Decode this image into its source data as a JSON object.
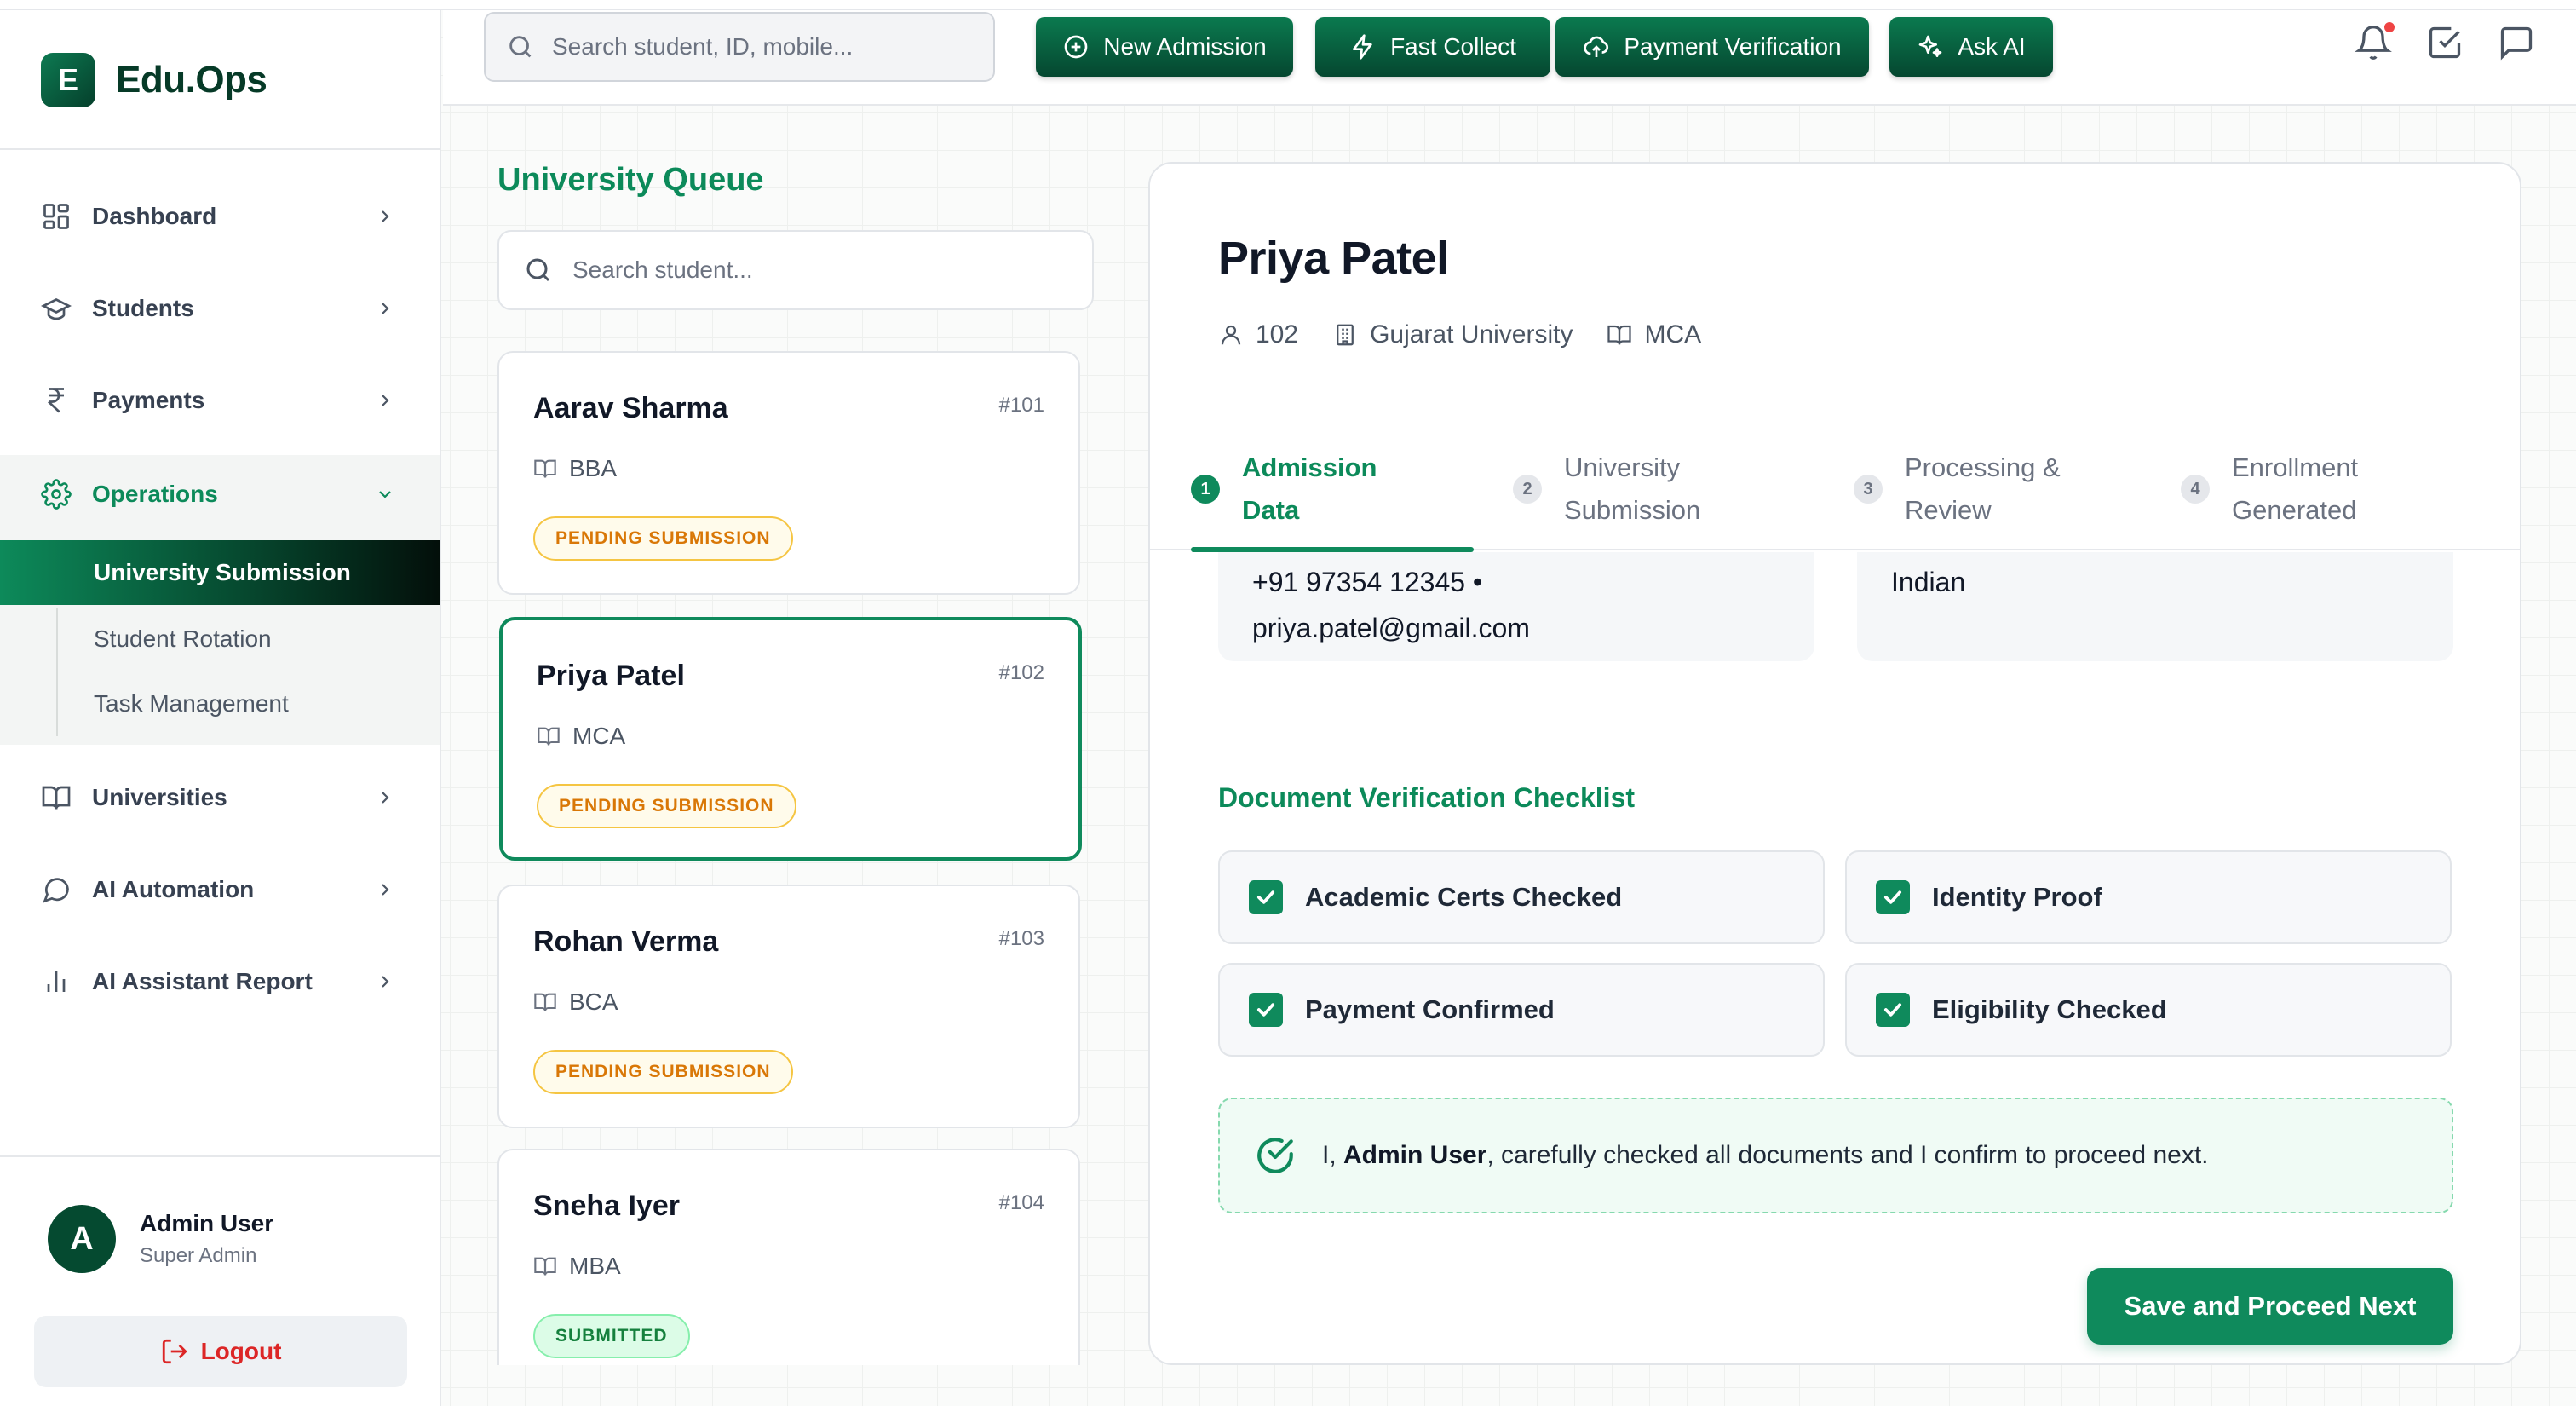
{
  "brand": {
    "logo_letter": "E",
    "name": "Edu.Ops"
  },
  "sidebar": {
    "items": [
      {
        "label": "Dashboard",
        "icon": "grid-icon"
      },
      {
        "label": "Students",
        "icon": "graduation-cap-icon"
      },
      {
        "label": "Payments",
        "icon": "rupee-icon"
      },
      {
        "label": "Operations",
        "icon": "gear-icon",
        "expanded": true
      },
      {
        "label": "Universities",
        "icon": "book-open-icon"
      },
      {
        "label": "AI Automation",
        "icon": "message-circle-icon"
      },
      {
        "label": "AI Assistant Report",
        "icon": "bar-chart-icon"
      }
    ],
    "sub_items": [
      {
        "label": "University Submission",
        "active": true
      },
      {
        "label": "Student Rotation",
        "active": false
      },
      {
        "label": "Task Management",
        "active": false
      }
    ],
    "user": {
      "initial": "A",
      "name": "Admin User",
      "role": "Super Admin"
    },
    "logout_label": "Logout"
  },
  "topbar": {
    "search_placeholder": "Search student, ID, mobile...",
    "actions": [
      {
        "label": "New Admission",
        "icon": "plus-circle-icon"
      },
      {
        "label": "Fast Collect",
        "icon": "lightning-icon"
      },
      {
        "label": "Payment Verification",
        "icon": "cloud-upload-icon"
      },
      {
        "label": "Ask AI",
        "icon": "sparkles-icon"
      }
    ],
    "has_notification": true
  },
  "queue": {
    "title": "University Queue",
    "search_placeholder": "Search student...",
    "students": [
      {
        "name": "Aarav Sharma",
        "id": "#101",
        "course": "BBA",
        "status": "PENDING SUBMISSION",
        "selected": false
      },
      {
        "name": "Priya Patel",
        "id": "#102",
        "course": "MCA",
        "status": "PENDING SUBMISSION",
        "selected": true
      },
      {
        "name": "Rohan Verma",
        "id": "#103",
        "course": "BCA",
        "status": "PENDING SUBMISSION",
        "selected": false
      },
      {
        "name": "Sneha Iyer",
        "id": "#104",
        "course": "MBA",
        "status": "SUBMITTED",
        "selected": false
      }
    ]
  },
  "detail": {
    "name": "Priya Patel",
    "student_id": "102",
    "university": "Gujarat University",
    "course": "MCA",
    "steps": [
      {
        "num": "1",
        "label": "Admission\nData",
        "active": true
      },
      {
        "num": "2",
        "label": "University\nSubmission",
        "active": false
      },
      {
        "num": "3",
        "label": "Processing &\nReview",
        "active": false
      },
      {
        "num": "4",
        "label": "Enrollment\nGenerated",
        "active": false
      }
    ],
    "contact_line1": "+91 97354 12345 •",
    "contact_line2": "priya.patel@gmail.com",
    "nationality": "Indian",
    "checklist_title": "Document Verification Checklist",
    "checklist": [
      {
        "label": "Academic Certs Checked",
        "checked": true
      },
      {
        "label": "Identity Proof",
        "checked": true
      },
      {
        "label": "Payment Confirmed",
        "checked": true
      },
      {
        "label": "Eligibility Checked",
        "checked": true
      }
    ],
    "confirm_prefix": "I, ",
    "confirm_user": "Admin User",
    "confirm_suffix": ", carefully checked all documents and I confirm to proceed next.",
    "save_label": "Save and Proceed Next"
  },
  "colors": {
    "brand_green": "#0f8a5c",
    "dark_green": "#054730",
    "pending_amber": "#d97706",
    "submitted_green": "#15803d",
    "logout_red": "#dc2626"
  }
}
